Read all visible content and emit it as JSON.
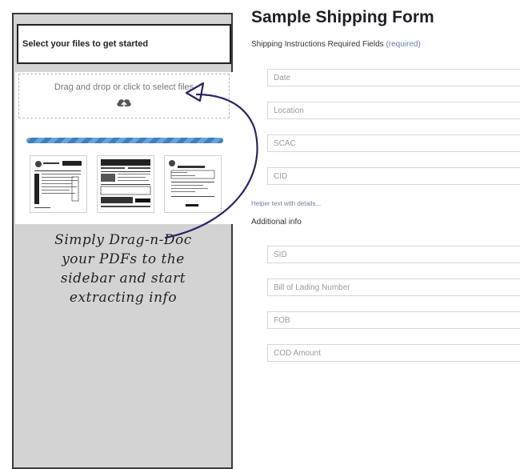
{
  "sidebar": {
    "header": "Select your files to get started",
    "dropzone_text": "Drag and drop or click to select files",
    "upload_icon": "cloud-upload-icon",
    "thumbnails": [
      {
        "name": "pdf-thumbnail-1"
      },
      {
        "name": "pdf-thumbnail-2"
      },
      {
        "name": "pdf-thumbnail-3"
      }
    ],
    "note_lines": [
      "Simply Drag-n-Doc",
      "your PDFs to the",
      "sidebar and start",
      "extracting info"
    ]
  },
  "form": {
    "title": "Sample Shipping Form",
    "subtitle": "Shipping Instructions Required Fields",
    "required_tag": "(required)",
    "required_fields": [
      {
        "placeholder": "Date"
      },
      {
        "placeholder": "Location"
      },
      {
        "placeholder": "SCAC"
      },
      {
        "placeholder": "CID"
      }
    ],
    "helper_text": "Helper text with details...",
    "additional_title": "Additional info",
    "additional_fields": [
      {
        "placeholder": "SID"
      },
      {
        "placeholder": "Bill of Lading Number"
      },
      {
        "placeholder": "FOB"
      },
      {
        "placeholder": "COD Amount"
      }
    ]
  },
  "colors": {
    "sidebar_bg": "#d3d3d3",
    "arrow": "#2a2466",
    "progress": "#3d7fbf",
    "helper": "#6b7fa8"
  }
}
